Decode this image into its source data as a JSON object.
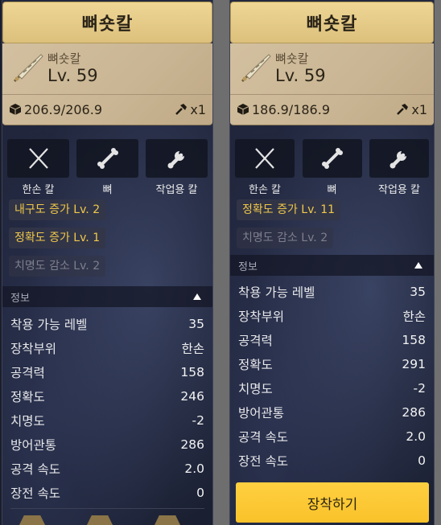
{
  "left_card": {
    "title": "뼈숏칼",
    "item_name": "뼈숏칼",
    "level": "Lv. 59",
    "durability": "206.9/206.9",
    "count": "x1",
    "types": [
      "한손 칼",
      "뼈",
      "작업용 칼"
    ],
    "tags": [
      {
        "label": "내구도 증가 Lv. 2",
        "active": true
      },
      {
        "label": "정확도 증가 Lv. 1",
        "active": true
      },
      {
        "label": "치명도 감소 Lv. 2",
        "active": false
      }
    ],
    "info_title": "정보",
    "stats": [
      {
        "label": "착용 가능 레벨",
        "value": "35"
      },
      {
        "label": "장착부위",
        "value": "한손"
      },
      {
        "label": "공격력",
        "value": "158"
      },
      {
        "label": "정확도",
        "value": "246"
      },
      {
        "label": "치명도",
        "value": "-2"
      },
      {
        "label": "방어관통",
        "value": "286"
      },
      {
        "label": "공격 속도",
        "value": "2.0"
      },
      {
        "label": "장전 속도",
        "value": "0"
      }
    ]
  },
  "right_card": {
    "title": "뼈숏칼",
    "item_name": "뼈숏칼",
    "level": "Lv. 59",
    "durability": "186.9/186.9",
    "count": "x1",
    "types": [
      "한손 칼",
      "뼈",
      "작업용 칼"
    ],
    "tags": [
      {
        "label": "정확도 증가 Lv. 11",
        "active": true
      },
      {
        "label": "치명도 감소 Lv. 2",
        "active": false
      }
    ],
    "info_title": "정보",
    "stats": [
      {
        "label": "착용 가능 레벨",
        "value": "35"
      },
      {
        "label": "장착부위",
        "value": "한손"
      },
      {
        "label": "공격력",
        "value": "158"
      },
      {
        "label": "정확도",
        "value": "291"
      },
      {
        "label": "치명도",
        "value": "-2"
      },
      {
        "label": "방어관통",
        "value": "286"
      },
      {
        "label": "공격 속도",
        "value": "2.0"
      },
      {
        "label": "장전 속도",
        "value": "0"
      }
    ],
    "equip_label": "장착하기"
  },
  "icons": {
    "weight": "cube-icon",
    "count": "hammer-icon",
    "type_1": "crossed-blades-icon",
    "type_2": "bone-icon",
    "type_3": "wrench-icon",
    "collapse": "triangle-up-icon"
  },
  "colors": {
    "title_bar": "#e8cf8d",
    "summary_bg": "#cdb999",
    "tag_active": "#f0c84a",
    "tag_inactive": "#7d7f8c",
    "equip_button": "#fcc936"
  }
}
